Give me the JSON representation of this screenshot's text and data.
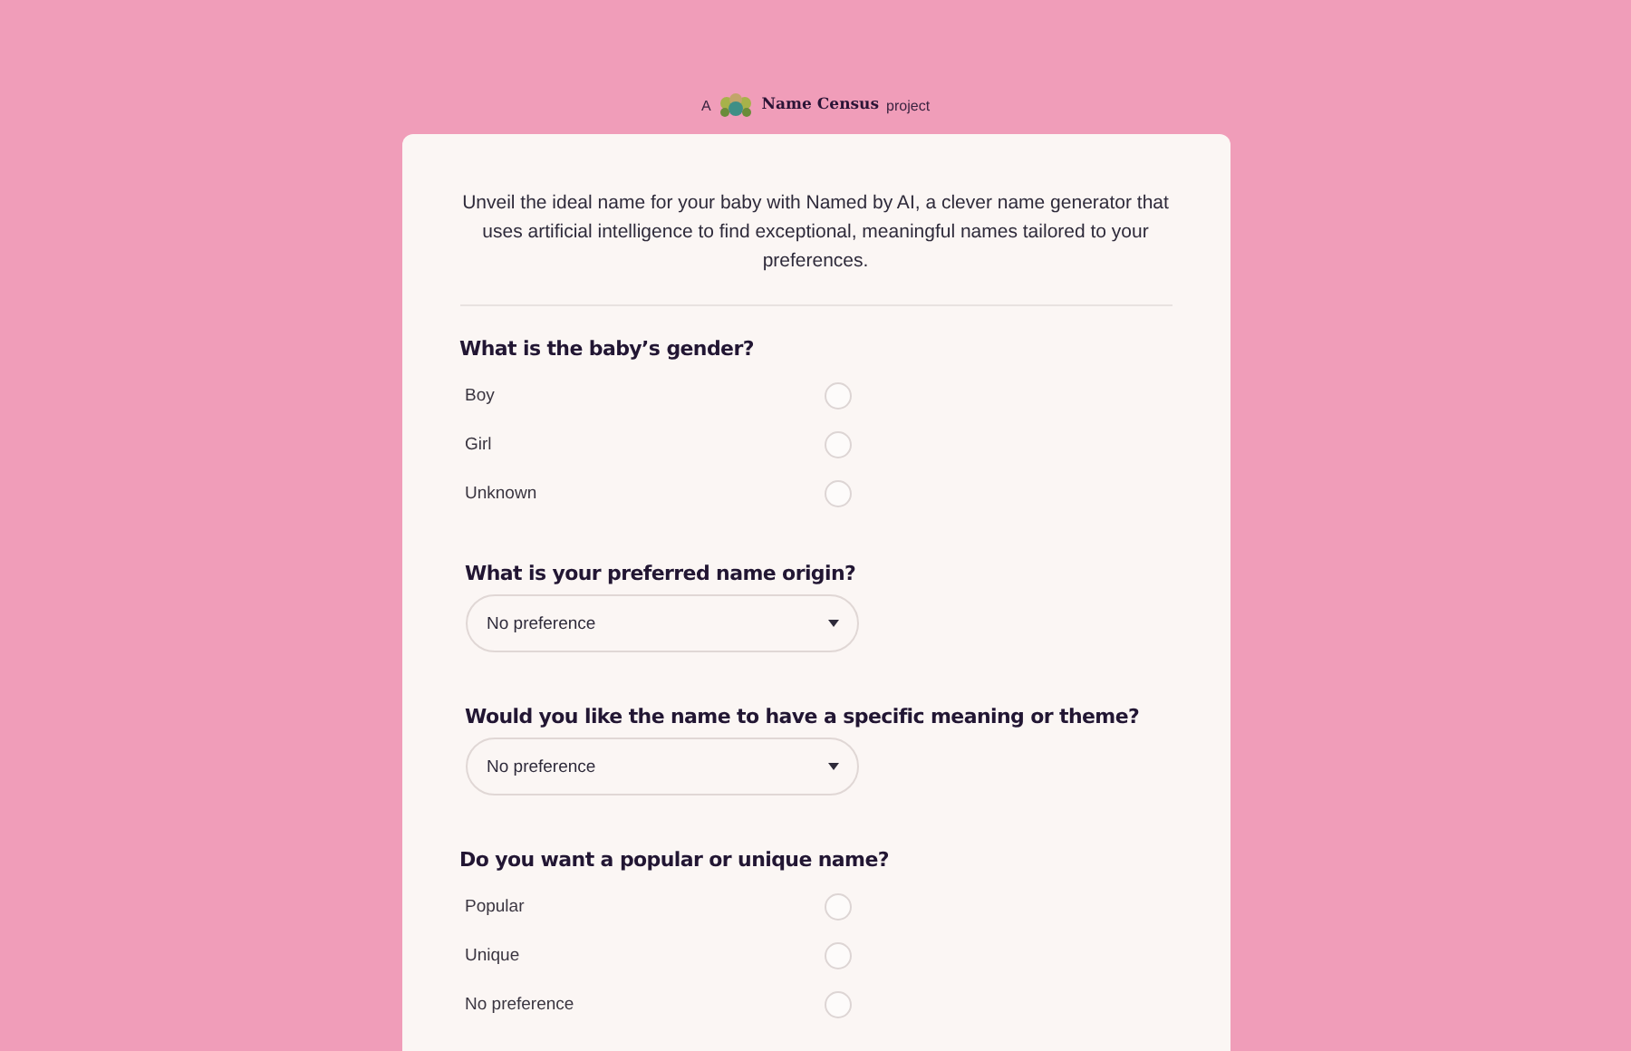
{
  "header": {
    "prefix": "A",
    "brand": "Name Census",
    "suffix": "project"
  },
  "intro": "Unveil the ideal name for your baby with Named by AI, a clever name generator that uses artificial intelligence to find exceptional, meaningful names tailored to your preferences.",
  "questions": [
    {
      "kind": "radio",
      "title": "What is the baby’s gender?",
      "options": [
        {
          "label": "Boy",
          "selected": false
        },
        {
          "label": "Girl",
          "selected": false
        },
        {
          "label": "Unknown",
          "selected": false
        }
      ]
    },
    {
      "kind": "select",
      "title": "What is your preferred name origin?",
      "value": "No preference"
    },
    {
      "kind": "select",
      "title": "Would you like the name to have a specific meaning or theme?",
      "value": "No preference"
    },
    {
      "kind": "radio",
      "title": "Do you want a popular or unique name?",
      "options": [
        {
          "label": "Popular",
          "selected": false
        },
        {
          "label": "Unique",
          "selected": false
        },
        {
          "label": "No preference",
          "selected": false
        }
      ]
    }
  ]
}
